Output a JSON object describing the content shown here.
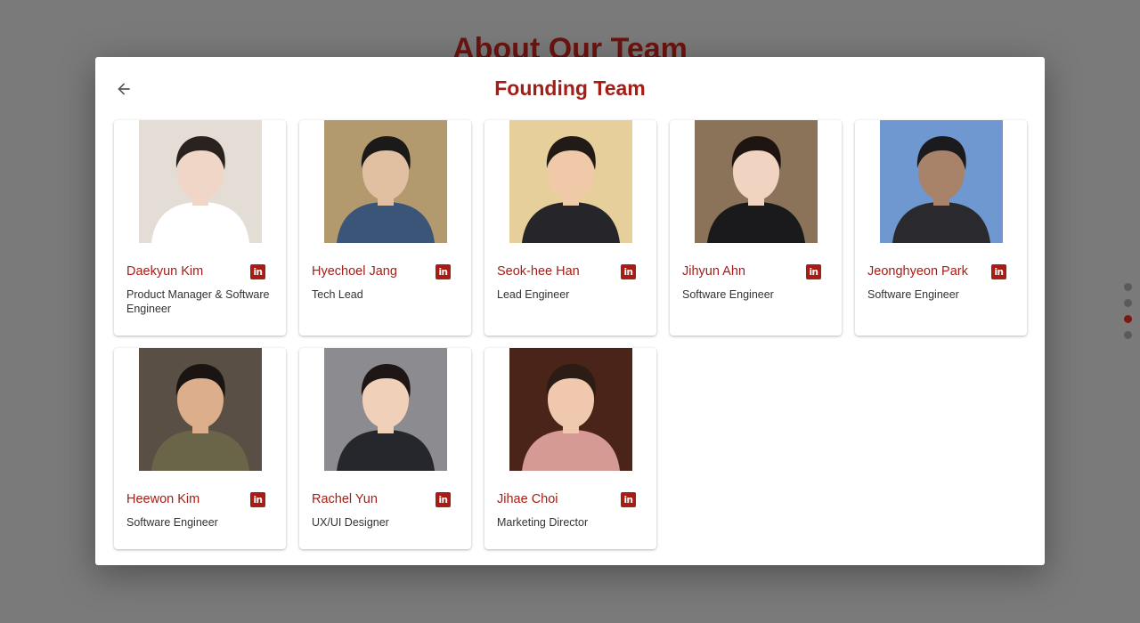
{
  "background": {
    "title": "About Our Team"
  },
  "modal": {
    "title": "Founding Team",
    "back_icon": "arrow-left-icon"
  },
  "members": [
    {
      "name": "Daekyun Kim",
      "role": "Product Manager & Software Engineer",
      "photo": {
        "bg": "#e4ddd5",
        "skin": "#efd6c6",
        "hair": "#2a221e",
        "cloth": "#ffffff"
      }
    },
    {
      "name": "Hyechoel Jang",
      "role": "Tech Lead",
      "photo": {
        "bg": "#b39a6e",
        "skin": "#e1c0a2",
        "hair": "#1c1a18",
        "cloth": "#3a5578"
      }
    },
    {
      "name": "Seok-hee Han",
      "role": "Lead Engineer",
      "photo": {
        "bg": "#e6cf9a",
        "skin": "#f0c9a9",
        "hair": "#211a16",
        "cloth": "#26262a"
      }
    },
    {
      "name": "Jihyun Ahn",
      "role": "Software Engineer",
      "photo": {
        "bg": "#8a7358",
        "skin": "#f1d3c2",
        "hair": "#1e1512",
        "cloth": "#1a1a1c"
      }
    },
    {
      "name": "Jeonghyeon Park",
      "role": "Software Engineer",
      "photo": {
        "bg": "#6e98cf",
        "skin": "#a9826a",
        "hair": "#1b1b1e",
        "cloth": "#2a2a2e"
      }
    },
    {
      "name": "Heewon Kim",
      "role": "Software Engineer",
      "photo": {
        "bg": "#5a4f44",
        "skin": "#dcae8c",
        "hair": "#1a1512",
        "cloth": "#6a6448"
      }
    },
    {
      "name": "Rachel Yun",
      "role": "UX/UI Designer",
      "photo": {
        "bg": "#8c8c90",
        "skin": "#f1d0ba",
        "hair": "#1e1614",
        "cloth": "#25272c"
      }
    },
    {
      "name": "Jihae Choi",
      "role": "Marketing Director",
      "photo": {
        "bg": "#4a2418",
        "skin": "#f0c8ad",
        "hair": "#2b1c16",
        "cloth": "#d59a94"
      }
    }
  ],
  "linkedin_icon": "linkedin-icon",
  "linkedin_glyph": "in",
  "colors": {
    "accent": "#a51e16",
    "overlay": "#7a7a7a"
  }
}
